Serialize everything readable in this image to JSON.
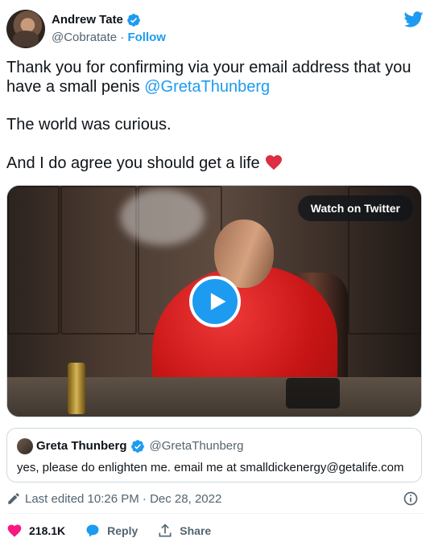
{
  "author": {
    "name": "Andrew Tate",
    "handle": "@Cobratate",
    "separator": "·",
    "follow_label": "Follow"
  },
  "tweet": {
    "line1": "Thank you for confirming via your email address that you have a small penis ",
    "mention": "@GretaThunberg",
    "line2": "The world was curious.",
    "line3": "And I do agree you should get a life "
  },
  "media": {
    "watch_label": "Watch on Twitter"
  },
  "quoted_tweet": {
    "name": "Greta Thunberg",
    "handle": "@GretaThunberg",
    "text": "yes, please do enlighten me. email me at smalldickenergy@getalife.com"
  },
  "edit_info": {
    "text": "Last edited 10:26 PM · Dec 28, 2022"
  },
  "actions": {
    "likes": "218.1K",
    "reply_label": "Reply",
    "share_label": "Share"
  },
  "icons": {
    "verified": "verified-badge",
    "twitter": "twitter-bird",
    "heart_emoji": "red-heart",
    "play": "play-triangle",
    "pencil": "pencil",
    "info": "info-circle",
    "like": "heart",
    "reply": "speech-bubble",
    "share": "upload-arrow"
  },
  "colors": {
    "blue": "#1d9bf0",
    "pink": "#f91880",
    "muted": "#536471",
    "text": "#0f1419"
  }
}
